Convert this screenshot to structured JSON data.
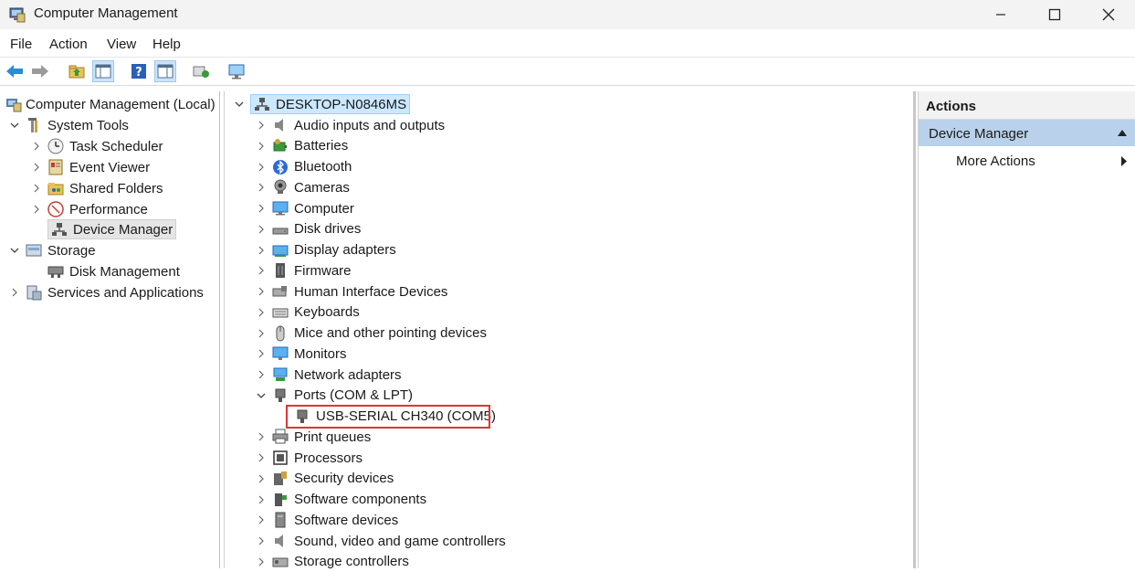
{
  "window": {
    "title": "Computer Management"
  },
  "menu": [
    "File",
    "Action",
    "View",
    "Help"
  ],
  "left_tree": {
    "root": "Computer Management (Local)",
    "system_tools": "System Tools",
    "task_scheduler": "Task Scheduler",
    "event_viewer": "Event Viewer",
    "shared_folders": "Shared Folders",
    "performance": "Performance",
    "device_manager": "Device Manager",
    "storage": "Storage",
    "disk_management": "Disk Management",
    "services": "Services and Applications"
  },
  "device_tree": {
    "computer": "DESKTOP-N0846MS",
    "categories": [
      "Audio inputs and outputs",
      "Batteries",
      "Bluetooth",
      "Cameras",
      "Computer",
      "Disk drives",
      "Display adapters",
      "Firmware",
      "Human Interface Devices",
      "Keyboards",
      "Mice and other pointing devices",
      "Monitors",
      "Network adapters",
      "Ports (COM & LPT)",
      "Print queues",
      "Processors",
      "Security devices",
      "Software components",
      "Software devices",
      "Sound, video and game controllers",
      "Storage controllers"
    ],
    "port_child": "USB-SERIAL CH340 (COM5)"
  },
  "actions": {
    "header": "Actions",
    "section": "Device Manager",
    "more": "More Actions"
  },
  "colors": {
    "highlight_border": "#e03434",
    "selection": "#cce8ff",
    "actions_bar": "#b9d1ea"
  }
}
